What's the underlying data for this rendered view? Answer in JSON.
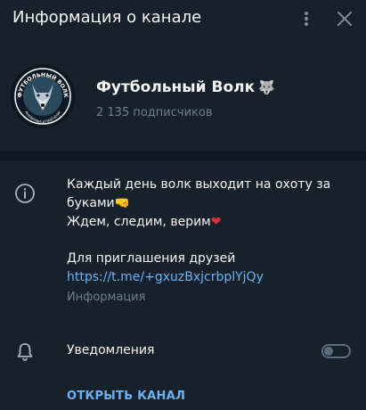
{
  "header": {
    "title": "Информация о канале",
    "more_icon": "more-vertical-icon",
    "close_icon": "close-icon"
  },
  "profile": {
    "avatar_text": "ФУТБОЛЬНЫЙ ВОЛК",
    "avatar_subtext": "АНАЛИТИКА И ПРОГНОЗЫ",
    "name": "Футбольный Волк",
    "name_emoji": "🐺",
    "subscribers": "2 135 подписчиков"
  },
  "description": {
    "icon": "info-icon",
    "line1": "Каждый день волк выходит на охоту за",
    "line2": "буками",
    "line2_emoji": "🤜",
    "line3": "Ждем, следим, верим",
    "line3_emoji": "❤",
    "invite_label": "Для приглашения друзей",
    "invite_link": "https://t.me/+gxuzBxjcrbplYjQy",
    "caption": "Информация"
  },
  "notifications": {
    "icon": "bell-icon",
    "label": "Уведомления",
    "enabled": false
  },
  "open_channel_label": "ОТКРЫТЬ КАНАЛ",
  "colors": {
    "background": "#17212b",
    "accent": "#6ab3f3",
    "secondary_text": "#6d7f8f",
    "divider": "#0e1621"
  }
}
